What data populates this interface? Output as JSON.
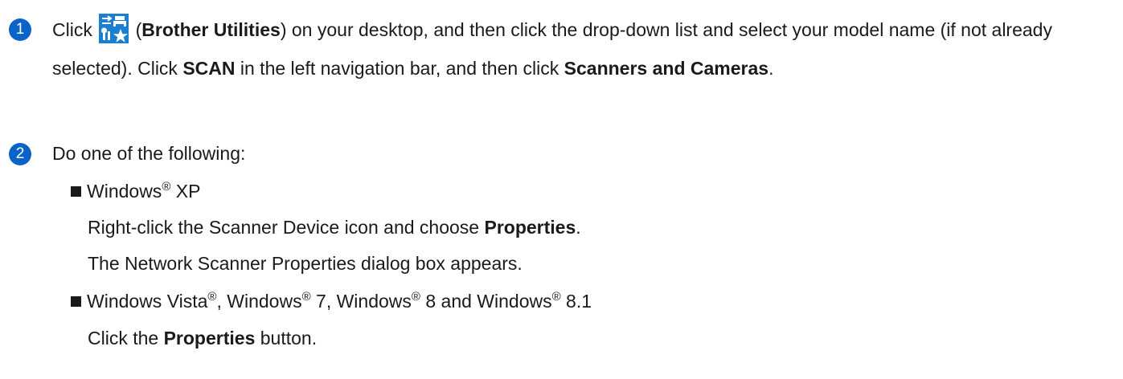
{
  "step1": {
    "number": "1",
    "click_word": "Click",
    "app_name": "Brother Utilities",
    "icon": "brother-utilities-icon",
    "text_a": " on your desktop, and then click the drop-down list and select your model name (if not already selected). Click ",
    "scan_label": "SCAN",
    "text_b": " in the left navigation bar, and then click ",
    "scanners_label": "Scanners and Cameras",
    "text_c": "."
  },
  "step2": {
    "number": "2",
    "intro": "Do one of the following:",
    "options": [
      {
        "os": "Windows",
        "os_suffix": " XP",
        "instruction_pre": "Right-click the Scanner Device icon and choose ",
        "instruction_bold": "Properties",
        "instruction_post": ".",
        "result": "The Network Scanner Properties dialog box appears."
      },
      {
        "os_a": "Windows Vista",
        "os_b": ", Windows",
        "os_c": " 7, Windows",
        "os_d": " 8 and Windows",
        "os_e": " 8.1",
        "instruction_pre": "Click the ",
        "instruction_bold": "Properties",
        "instruction_post": " button."
      }
    ]
  },
  "registered_mark": "®",
  "colors": {
    "accent": "#0a63c7",
    "icon_blue": "#1b7fd1",
    "text": "#1a1a1a"
  }
}
